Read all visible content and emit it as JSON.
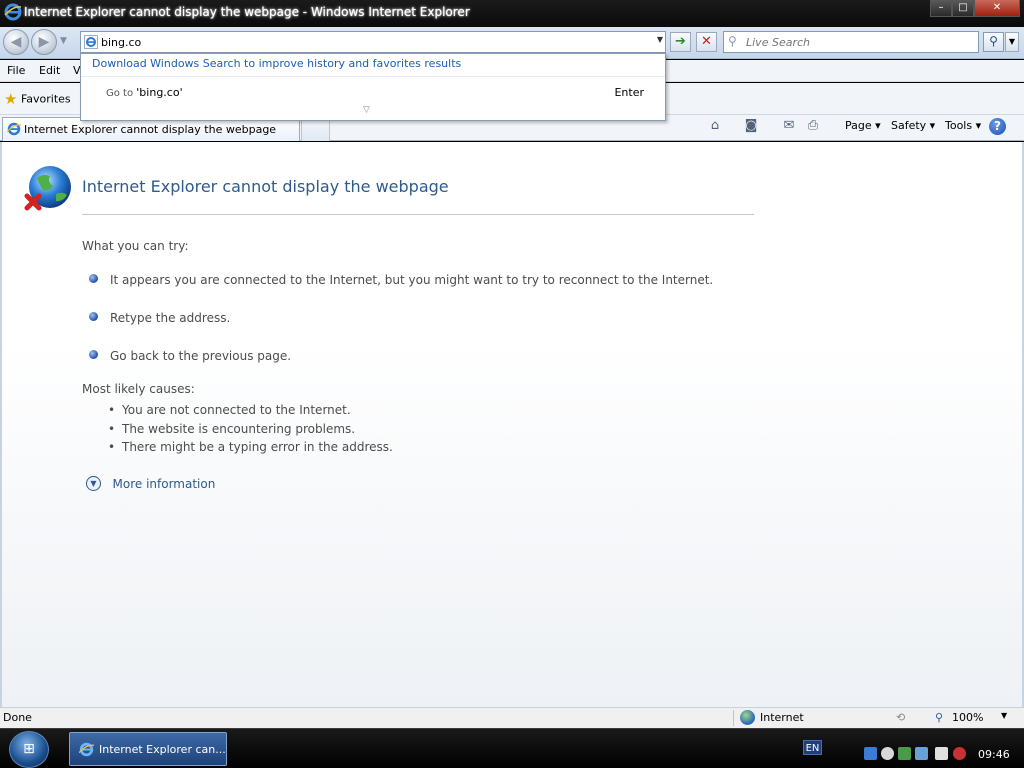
{
  "window": {
    "title": "Internet Explorer cannot display the webpage - Windows Internet Explorer",
    "minimize": "–",
    "maximize": "□",
    "close": "✕"
  },
  "address_bar": {
    "url": "bing.co",
    "search_placeholder": "Live Search"
  },
  "menu": [
    "File",
    "Edit",
    "V"
  ],
  "favorites": {
    "label": "Favorites"
  },
  "tab": {
    "label": "Internet Explorer cannot display the webpage"
  },
  "command_bar": {
    "page": "Page ▾",
    "safety": "Safety ▾",
    "tools": "Tools ▾",
    "help": "?"
  },
  "autocomplete": {
    "download_link": "Download Windows Search to improve history and favorites results",
    "goto_prefix": "Go to",
    "goto_query": "'bing.co'",
    "enter_label": "Enter",
    "more_arrow": "▽"
  },
  "page": {
    "heading": "Internet Explorer cannot display the webpage",
    "try_heading": "What you can try:",
    "try_items": [
      "It appears you are connected to the Internet, but you might want to try to reconnect to the Internet.",
      "Retype the address.",
      "Go back to the previous page."
    ],
    "causes_heading": "Most likely causes:",
    "causes": [
      "You are not connected to the Internet.",
      "The website is encountering problems.",
      "There might be a typing error in the address."
    ],
    "more_info": "More information"
  },
  "status_bar": {
    "status": "Done",
    "zone": "Internet",
    "zoom": "100%"
  },
  "taskbar": {
    "task_label": "Internet Explorer can...",
    "language": "EN",
    "clock": "09:46"
  },
  "colors": {
    "heading": "#2f5a8c",
    "link": "#1a5fb4",
    "body_text": "#4c4c4c"
  },
  "icons": {
    "app": "ie-logo-icon",
    "error_globe": "globe-error-icon",
    "home": "home-icon",
    "feeds": "rss-icon",
    "mail": "mail-icon",
    "print": "printer-icon"
  }
}
